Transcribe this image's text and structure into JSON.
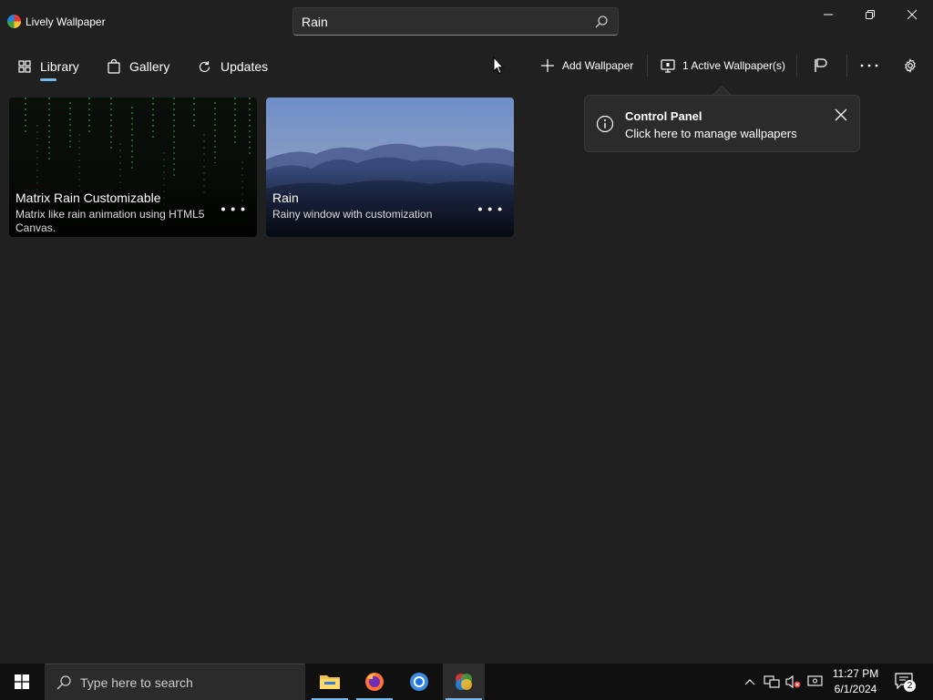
{
  "app": {
    "title": "Lively Wallpaper"
  },
  "search": {
    "value": "Rain"
  },
  "nav": {
    "library": "Library",
    "gallery": "Gallery",
    "updates": "Updates"
  },
  "commands": {
    "add_wallpaper": "Add Wallpaper",
    "active_wallpapers": "1 Active Wallpaper(s)"
  },
  "cards": [
    {
      "title": "Matrix Rain Customizable",
      "desc": "Matrix like rain animation using HTML5 Canvas."
    },
    {
      "title": "Rain",
      "desc": "Rainy window with customization"
    }
  ],
  "teaching_tip": {
    "title": "Control Panel",
    "subtitle": "Click here to manage wallpapers"
  },
  "taskbar": {
    "search_placeholder": "Type here to search",
    "time": "11:27 PM",
    "date": "6/1/2024",
    "notification_count": "2"
  },
  "colors": {
    "accent": "#76b9ed",
    "background": "#202020",
    "card_bg": "#2b2b2b"
  }
}
